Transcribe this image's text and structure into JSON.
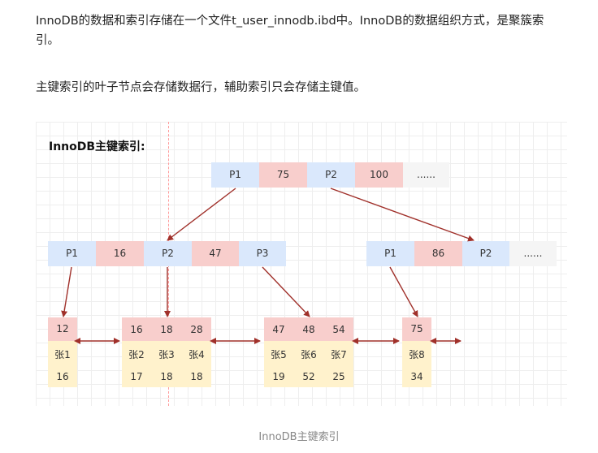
{
  "article": {
    "para1": "InnoDB的数据和索引存储在一个文件t_user_innodb.ibd中。InnoDB的数据组织方式，是聚簇索引。",
    "para2": "主键索引的叶子节点会存储数据行，辅助索引只会存储主键值。"
  },
  "diagram": {
    "title": "InnoDB主键索引:",
    "root": [
      "P1",
      "75",
      "P2",
      "100",
      "......"
    ],
    "internal_left": [
      "P1",
      "16",
      "P2",
      "47",
      "P3"
    ],
    "internal_right": [
      "P1",
      "86",
      "P2",
      "......"
    ],
    "leaves": [
      {
        "keys": [
          "12"
        ],
        "names": [
          "张1"
        ],
        "ages": [
          "16"
        ]
      },
      {
        "keys": [
          "16",
          "18",
          "28"
        ],
        "names": [
          "张2",
          "张3",
          "张4"
        ],
        "ages": [
          "17",
          "18",
          "18"
        ]
      },
      {
        "keys": [
          "47",
          "48",
          "54"
        ],
        "names": [
          "张5",
          "张6",
          "张7"
        ],
        "ages": [
          "19",
          "52",
          "25"
        ]
      },
      {
        "keys": [
          "75"
        ],
        "names": [
          "张8"
        ],
        "ages": [
          "34"
        ]
      }
    ],
    "colors": {
      "key_blue": "#dae8fc",
      "key_red": "#f8cecc",
      "leaf_yellow": "#fff2cc",
      "arrow": "#a0302a"
    }
  },
  "caption": "InnoDB主键索引"
}
